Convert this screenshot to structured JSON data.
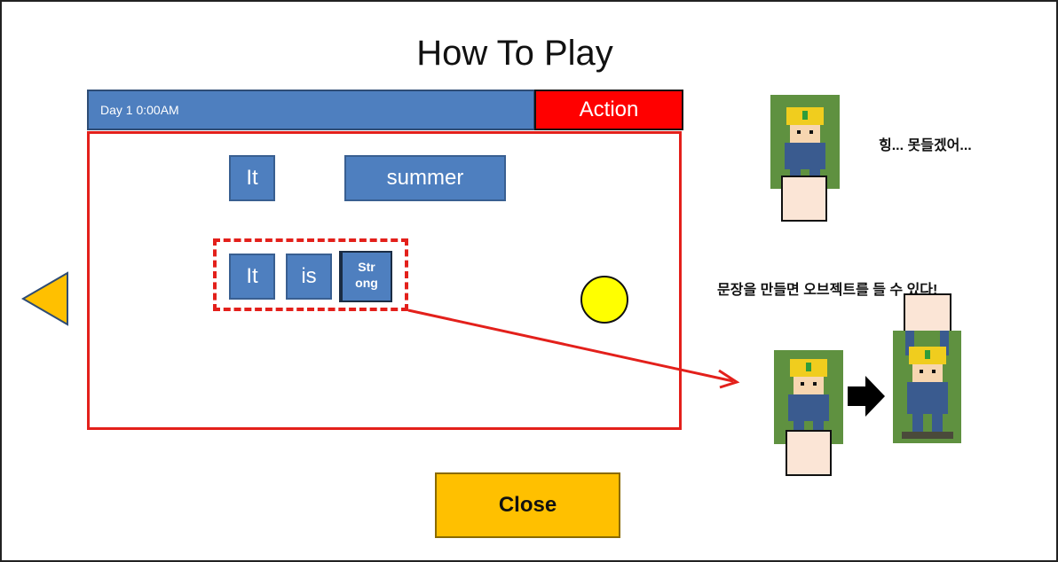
{
  "dialog": {
    "title": "How To Play",
    "close_label": "Close"
  },
  "game": {
    "status_label": "Day 1 0:00AM",
    "action_label": "Action",
    "words_top": [
      "It",
      "summer"
    ],
    "sentence_words": [
      "It",
      "is"
    ],
    "selected_word_line1": "Str",
    "selected_word_line2": "ong"
  },
  "tutorial": {
    "speech_cannot_lift": "힝... 못들겠어...",
    "speech_hint": "문장을 만들면 오브젝트를 들 수 있다!"
  },
  "colors": {
    "word_tile": "#4e7fbf",
    "action": "#ff0000",
    "highlight": "#e3201b",
    "coin": "#ffff00",
    "close_button": "#ffc000",
    "crate": "#fbe5d6"
  },
  "icons": {
    "prev": "triangle-left-icon",
    "arrow": "right-arrow-icon"
  }
}
